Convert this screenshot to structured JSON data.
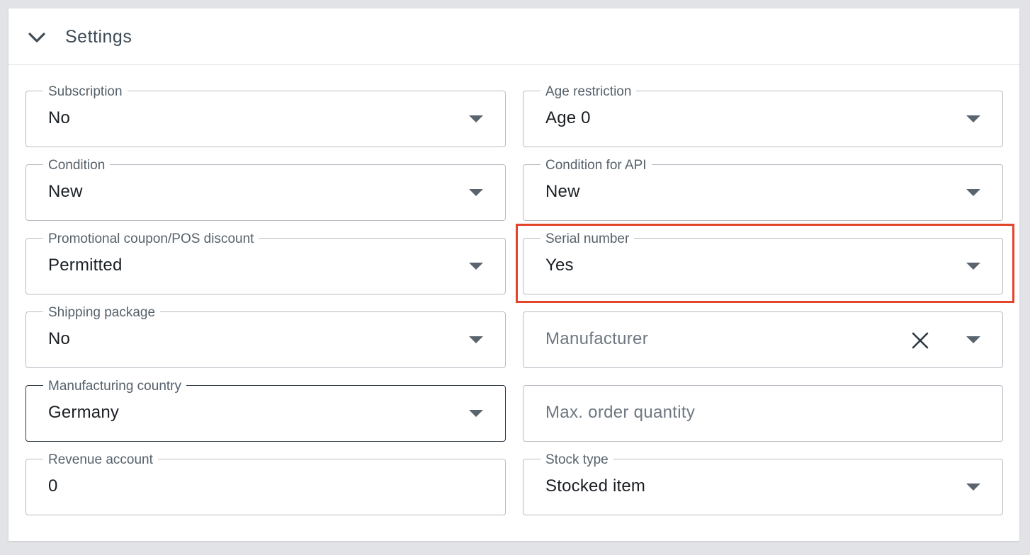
{
  "section": {
    "title": "Settings",
    "collapse_icon": "chevron-down-icon"
  },
  "fields": {
    "subscription": {
      "label": "Subscription",
      "value": "No"
    },
    "age_restriction": {
      "label": "Age restriction",
      "value": "Age 0"
    },
    "condition": {
      "label": "Condition",
      "value": "New"
    },
    "condition_api": {
      "label": "Condition for API",
      "value": "New"
    },
    "promo_coupon": {
      "label": "Promotional coupon/POS discount",
      "value": "Permitted"
    },
    "serial_number": {
      "label": "Serial number",
      "value": "Yes"
    },
    "shipping_package": {
      "label": "Shipping package",
      "value": "No"
    },
    "manufacturer": {
      "placeholder": "Manufacturer",
      "clear_icon": "close-icon"
    },
    "manufacturing_country": {
      "label": "Manufacturing country",
      "value": "Germany"
    },
    "max_order_quantity": {
      "placeholder": "Max. order quantity"
    },
    "revenue_account": {
      "label": "Revenue account",
      "value": "0"
    },
    "stock_type": {
      "label": "Stock type",
      "value": "Stocked item"
    }
  },
  "colors": {
    "highlight": "#e3452b",
    "border": "#b7bdc3",
    "text": "#1a1f24",
    "label": "#56616b"
  }
}
